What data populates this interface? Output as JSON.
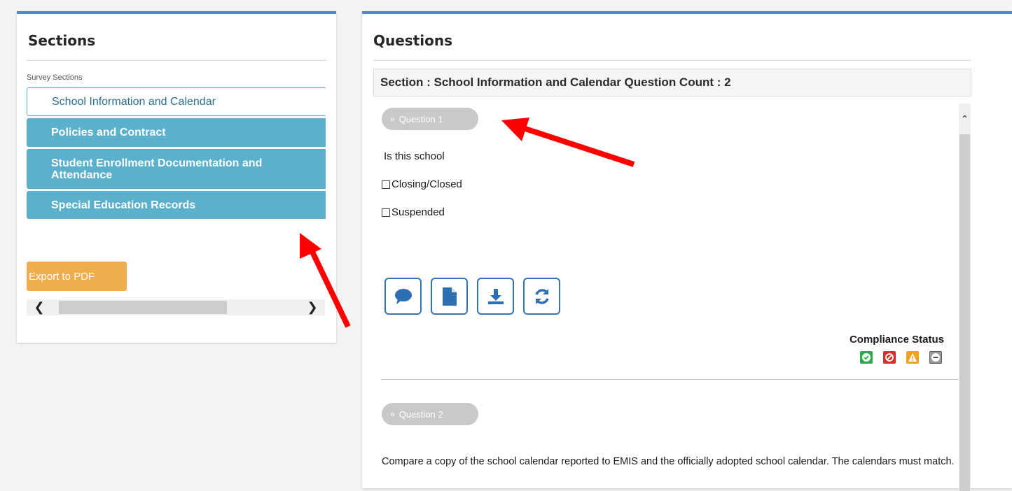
{
  "left_panel": {
    "title": "Sections",
    "survey_label": "Survey Sections",
    "sections": [
      {
        "label": "School Information and Calendar",
        "active": true
      },
      {
        "label": "Policies and Contract",
        "active": false
      },
      {
        "label": "Student Enrollment Documentation and Attendance",
        "active": false
      },
      {
        "label": "Special Education Records",
        "active": false
      }
    ],
    "export_label": "Export to PDF"
  },
  "right_panel": {
    "title": "Questions",
    "section_header": "Section : School Information and Calendar Question Count : 2",
    "question1": {
      "pill": "Question 1",
      "text": "Is this school",
      "options": [
        "Closing/Closed",
        "Suspended"
      ]
    },
    "tools": [
      "comment-icon",
      "document-icon",
      "download-icon",
      "refresh-icon"
    ],
    "compliance_label": "Compliance Status",
    "status_icons": [
      {
        "name": "compliant-icon",
        "color": "#2fa84f"
      },
      {
        "name": "non-compliant-icon",
        "color": "#d63030"
      },
      {
        "name": "warning-icon",
        "color": "#f0a31f"
      },
      {
        "name": "not-applicable-icon",
        "color": "#9a9a9a"
      }
    ],
    "question2": {
      "pill": "Question 2",
      "text": "Compare a copy of the school calendar reported to EMIS and the officially adopted school calendar. The calendars must match."
    }
  },
  "colors": {
    "panel_accent": "#4f86c6",
    "section_tab": "#5bb0cc",
    "export_button": "#f0ad4e",
    "tool_border": "#3175b8",
    "annotation_arrow": "#ff0000"
  }
}
